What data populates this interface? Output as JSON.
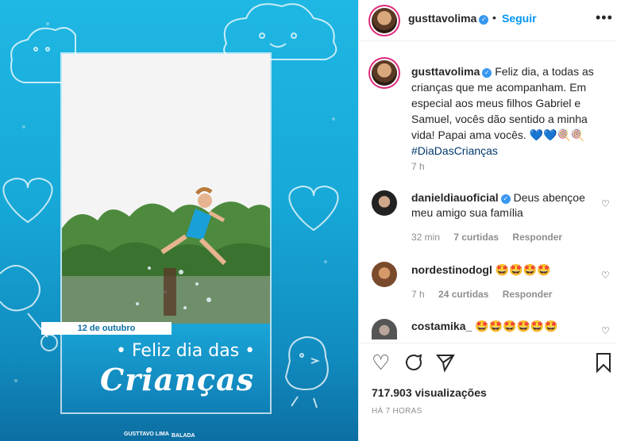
{
  "post": {
    "author": "gusttavolima",
    "follow_label": "Seguir",
    "caption_text": "Feliz dia, a todas as crianças que me acompanham. Em especial aos meus filhos Gabriel e Samuel, vocês dão sentido a minha vida! Papai ama vocês.",
    "caption_emojis": "💙💙🍭🍭",
    "hashtag": "#DiaDasCrianças",
    "caption_time": "7 h",
    "views": "717.903 visualizações",
    "posted_ago": "HÁ 7 HORAS"
  },
  "media": {
    "date_bar": "12 de outubro",
    "headline_line1": "• Feliz dia das •",
    "headline_line2": "Crianças",
    "logo_left": "GUSTTAVO LIMA",
    "logo_right": "BALADA"
  },
  "comments": [
    {
      "user": "danieldiauoficial",
      "verified": true,
      "text": "Deus abençoe meu amigo sua família",
      "time": "32 min",
      "likes": "7 curtidas",
      "reply": "Responder"
    },
    {
      "user": "nordestinodogl",
      "verified": false,
      "text": "🤩🤩🤩🤩",
      "time": "7 h",
      "likes": "24 curtidas",
      "reply": "Responder"
    },
    {
      "user": "costamika_",
      "verified": false,
      "text": "🤩🤩🤩🤩🤩🤩",
      "time": "",
      "likes": "",
      "reply": ""
    }
  ],
  "icons": {
    "more": "more-options-icon",
    "like": "heart-icon",
    "comment": "comment-icon",
    "share": "share-icon",
    "save": "bookmark-icon",
    "verified": "verified-badge-icon"
  },
  "colors": {
    "accent": "#0095f6",
    "media_bg": "#1fb7e3",
    "hashtag": "#00376b"
  }
}
